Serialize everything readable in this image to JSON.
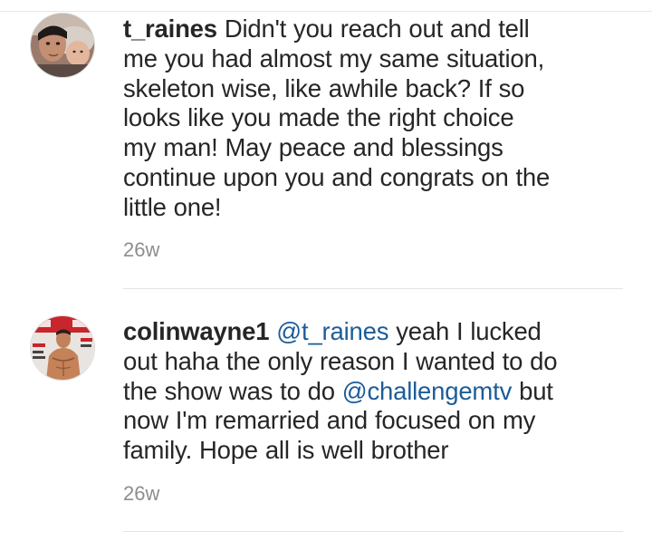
{
  "comments": [
    {
      "username": "t_raines",
      "avatar_icon": "profile-photo-two-faces",
      "lines": [
        "Didn't you reach out and tell",
        "me you had almost my same situation,",
        "skeleton wise, like awhile back? If so",
        "looks like you made the right choice",
        "my man! May peace and blessings",
        "continue upon you and congrats on the",
        "little one!"
      ],
      "timestamp": "26w"
    },
    {
      "username": "colinwayne1",
      "avatar_icon": "profile-photo-magazine-cover",
      "mention_1": "@t_raines",
      "line1_rest": "yeah I lucked",
      "line2": "out haha the only reason I wanted to do",
      "line3_start": "the show was to do",
      "mention_2": "@challengemtv",
      "line3_rest": "but",
      "line4": "now I'm remarried and focused on my",
      "line5": "family. Hope all is well brother",
      "timestamp": "26w"
    }
  ],
  "colors": {
    "text": "#262626",
    "mention": "#1d5c97",
    "timestamp": "#8e8e8e",
    "divider": "#e3e3e3"
  }
}
